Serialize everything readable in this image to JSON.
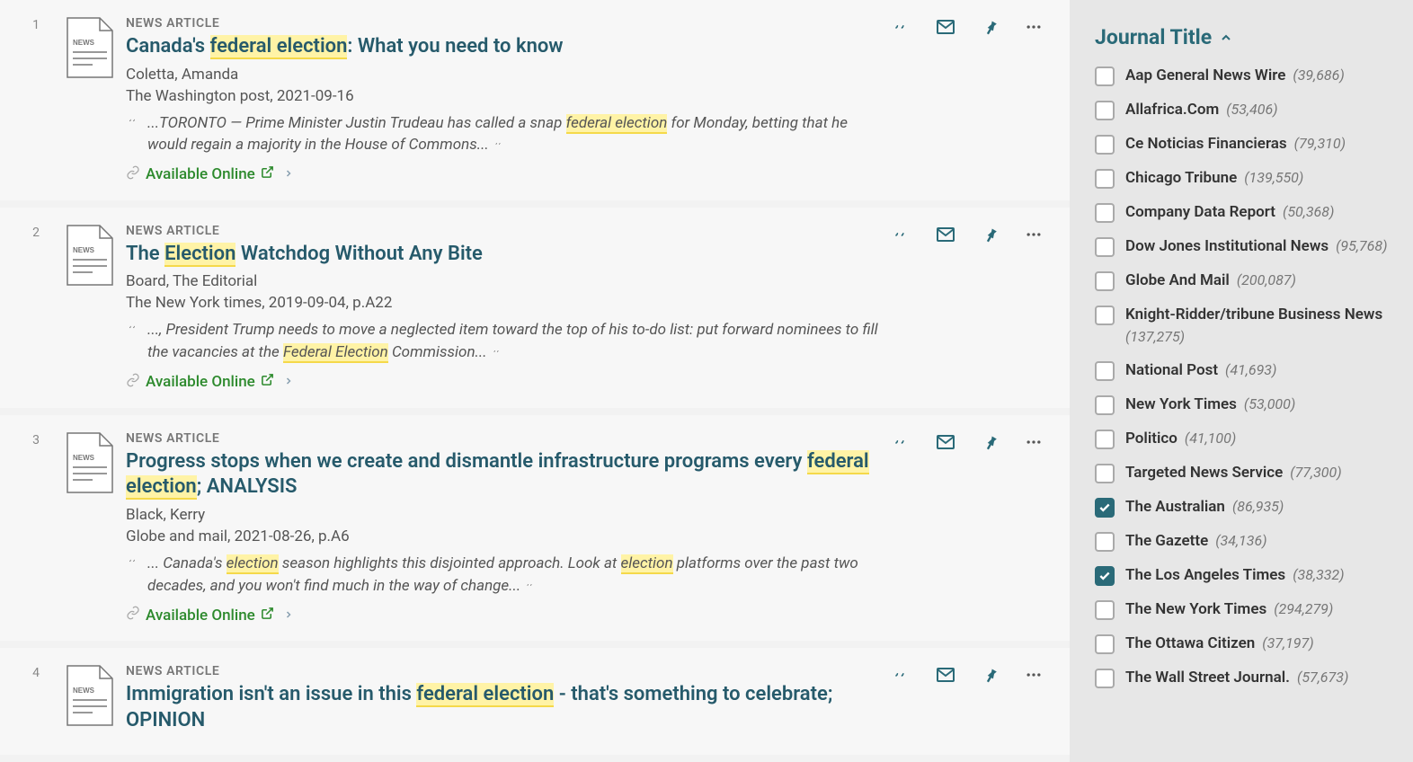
{
  "type_label": "NEWS ARTICLE",
  "available_online": "Available Online",
  "results": [
    {
      "number": "1",
      "title_parts": [
        {
          "t": "Canada's ",
          "hl": false
        },
        {
          "t": "federal election",
          "hl": true
        },
        {
          "t": ": What you need to know",
          "hl": false
        }
      ],
      "author": "Coletta, Amanda",
      "source": "The Washington post, 2021-09-16",
      "snippet_parts": [
        {
          "t": "...TORONTO — Prime Minister Justin Trudeau has called a snap ",
          "hl": false
        },
        {
          "t": "federal election",
          "hl": true
        },
        {
          "t": " for Monday, betting that he would regain a majority in the House of Commons...",
          "hl": false
        }
      ]
    },
    {
      "number": "2",
      "title_parts": [
        {
          "t": "The ",
          "hl": false
        },
        {
          "t": "Election",
          "hl": true
        },
        {
          "t": " Watchdog Without Any Bite",
          "hl": false
        }
      ],
      "author": "Board, The Editorial",
      "source": "The New York times, 2019-09-04, p.A22",
      "snippet_parts": [
        {
          "t": "..., President Trump needs to move a neglected item toward the top of his to-do list: put forward nominees to fill the vacancies at the ",
          "hl": false
        },
        {
          "t": "Federal Election",
          "hl": true
        },
        {
          "t": " Commission...",
          "hl": false
        }
      ]
    },
    {
      "number": "3",
      "title_parts": [
        {
          "t": "Progress stops when we create and dismantle infrastructure programs every ",
          "hl": false
        },
        {
          "t": "federal election",
          "hl": true
        },
        {
          "t": "; ANALYSIS",
          "hl": false
        }
      ],
      "author": "Black, Kerry",
      "source": "Globe and mail, 2021-08-26, p.A6",
      "snippet_parts": [
        {
          "t": "... Canada's ",
          "hl": false
        },
        {
          "t": "election",
          "hl": true
        },
        {
          "t": " season highlights this disjointed approach. Look at ",
          "hl": false
        },
        {
          "t": "election",
          "hl": true
        },
        {
          "t": " platforms over the past two decades, and you won't find much in the way of change...",
          "hl": false
        }
      ]
    },
    {
      "number": "4",
      "title_parts": [
        {
          "t": "Immigration isn't an issue in this ",
          "hl": false
        },
        {
          "t": "federal election",
          "hl": true
        },
        {
          "t": " - that's something to celebrate; OPINION",
          "hl": false
        }
      ],
      "author": "",
      "source": "",
      "snippet_parts": [],
      "truncated": true
    }
  ],
  "sidebar": {
    "heading": "Journal Title",
    "facets": [
      {
        "label": "Aap General News Wire",
        "count": "(39,686)",
        "checked": false
      },
      {
        "label": "Allafrica.Com",
        "count": "(53,406)",
        "checked": false
      },
      {
        "label": "Ce Noticias Financieras",
        "count": "(79,310)",
        "checked": false
      },
      {
        "label": "Chicago Tribune",
        "count": "(139,550)",
        "checked": false
      },
      {
        "label": "Company Data Report",
        "count": "(50,368)",
        "checked": false
      },
      {
        "label": "Dow Jones Institutional News",
        "count": "(95,768)",
        "checked": false
      },
      {
        "label": "Globe And Mail",
        "count": "(200,087)",
        "checked": false
      },
      {
        "label": "Knight-Ridder/tribune Business News",
        "count": "(137,275)",
        "checked": false
      },
      {
        "label": "National Post",
        "count": "(41,693)",
        "checked": false
      },
      {
        "label": "New York Times",
        "count": "(53,000)",
        "checked": false
      },
      {
        "label": "Politico",
        "count": "(41,100)",
        "checked": false
      },
      {
        "label": "Targeted News Service",
        "count": "(77,300)",
        "checked": false
      },
      {
        "label": "The Australian",
        "count": "(86,935)",
        "checked": true
      },
      {
        "label": "The Gazette",
        "count": "(34,136)",
        "checked": false
      },
      {
        "label": "The Los Angeles Times",
        "count": "(38,332)",
        "checked": true
      },
      {
        "label": "The New York Times",
        "count": "(294,279)",
        "checked": false
      },
      {
        "label": "The Ottawa Citizen",
        "count": "(37,197)",
        "checked": false
      },
      {
        "label": "The Wall Street Journal.",
        "count": "(57,673)",
        "checked": false
      }
    ]
  }
}
